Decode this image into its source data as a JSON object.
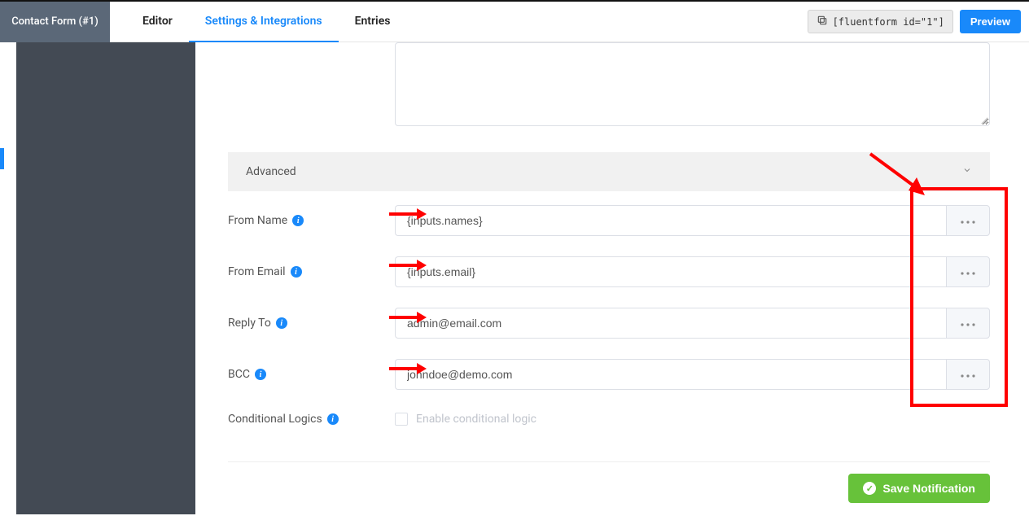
{
  "header": {
    "form_title": "Contact Form (#1)",
    "tabs": {
      "editor": "Editor",
      "settings": "Settings & Integrations",
      "entries": "Entries"
    },
    "shortcode": "[fluentform id=\"1\"]",
    "preview": "Preview"
  },
  "section": {
    "advanced": "Advanced"
  },
  "fields": {
    "from_name": {
      "label": "From Name",
      "value": "{inputs.names}"
    },
    "from_email": {
      "label": "From Email",
      "value": "{inputs.email}"
    },
    "reply_to": {
      "label": "Reply To",
      "value": "admin@email.com"
    },
    "bcc": {
      "label": "BCC",
      "value": "johndoe@demo.com"
    },
    "conditional": {
      "label": "Conditional Logics",
      "checkbox_label": "Enable conditional logic"
    }
  },
  "buttons": {
    "save": "Save Notification"
  }
}
